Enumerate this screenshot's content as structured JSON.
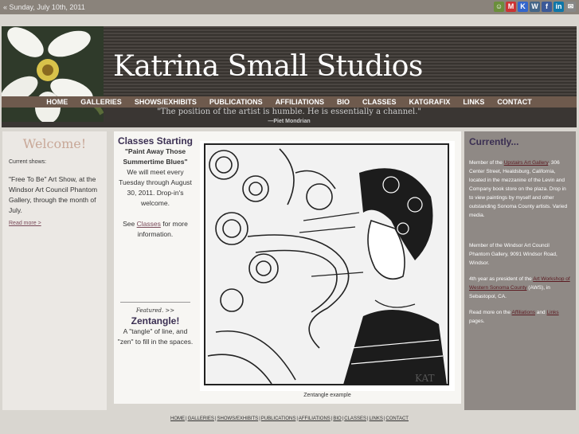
{
  "topbar": {
    "date": "« Sunday, July 10th, 2011"
  },
  "social": [
    {
      "name": "share",
      "color": "#6b8f3b",
      "glyph": "☺"
    },
    {
      "name": "gmail",
      "color": "#c33",
      "glyph": "M"
    },
    {
      "name": "k",
      "color": "#36c",
      "glyph": "K"
    },
    {
      "name": "wordpress",
      "color": "#468",
      "glyph": "W"
    },
    {
      "name": "facebook",
      "color": "#3b5998",
      "glyph": "f"
    },
    {
      "name": "linkedin",
      "color": "#0e76a8",
      "glyph": "in"
    },
    {
      "name": "email",
      "color": "#888",
      "glyph": "✉"
    }
  ],
  "header": {
    "title": "Katrina Small Studios",
    "quote": "\"The position of the artist is humble. He is essentially a channel.\"",
    "quote_author": "—Piet Mondrian"
  },
  "nav": [
    "HOME",
    "GALLERIES",
    "SHOWS/EXHIBITS",
    "PUBLICATIONS",
    "AFFILIATIONS",
    "BIO",
    "CLASSES",
    "KATGRAFIX",
    "LINKS",
    "CONTACT"
  ],
  "left": {
    "heading": "Welcome!",
    "label": "Current shows:",
    "text": "\"Free To Be\" Art Show, at the Windsor Art Council Phantom Gallery, through the month of July.",
    "more": "Read more >"
  },
  "classes": {
    "heading": "Classes Starting",
    "title": "\"Paint Away Those Summertime Blues\"",
    "body": "We will meet every Tuesday through August 30, 2011. Drop-in's welcome.",
    "see_pre": "See ",
    "see_link": "Classes",
    "see_post": " for more information."
  },
  "zentangle": {
    "featured": "Featured. >>",
    "heading": "Zentangle!",
    "body": "A \"tangle\" of line, and \"zen\" to fill in the spaces."
  },
  "art": {
    "caption": "Zentangle example",
    "signature": "KAT"
  },
  "right": {
    "heading": "Currently...",
    "p1_pre": "Member of the ",
    "p1_link": "Upstairs Art Gallery",
    "p1_post": ", 306 Center Street, Healdsburg, California, located in the mezzanine of the Levin and Company book store on the plaza. Drop in to view paintings by myself and other outstanding Sonoma County artists. Varied media.",
    "p2": "Member of the Windsor Art Council Phantom Gallery, 9091 Windsor Road, Windsor.",
    "p3_pre": "4th year as president of the ",
    "p3_link": "Art Workshop of Western Sonoma County",
    "p3_post": " (AWS), in Sebastopol, CA.",
    "p4_pre": "Read more on the ",
    "p4_link1": "Affiliations",
    "p4_mid": " and ",
    "p4_link2": "Links",
    "p4_post": " pages."
  },
  "footer": [
    "HOME",
    "GALLERIES",
    "SHOWS/EXHIBITS",
    "PUBLICATIONS",
    "AFFILIATIONS",
    "BIO",
    "CLASSES",
    "LINKS",
    "CONTACT"
  ]
}
